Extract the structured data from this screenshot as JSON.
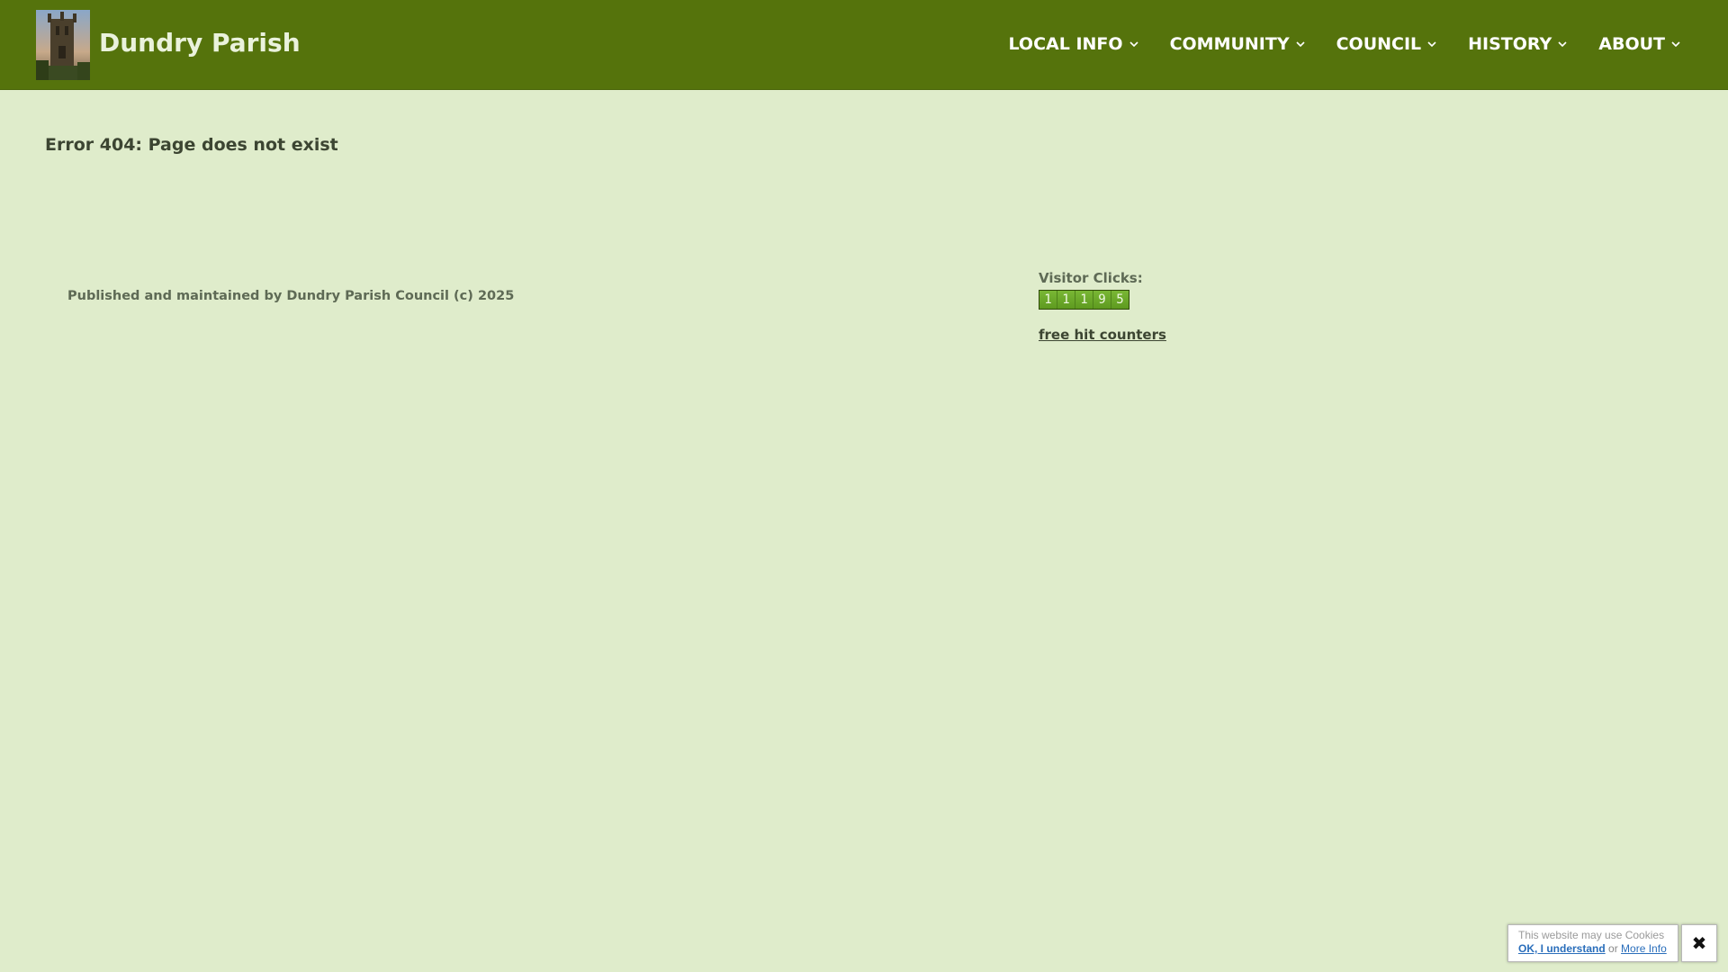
{
  "header": {
    "site_title": "Dundry Parish",
    "logo_icon": "church-tower-photo",
    "background": "#55730c",
    "nav": [
      {
        "label": "LOCAL INFO",
        "icon": "chevron-down-icon"
      },
      {
        "label": "COMMUNITY",
        "icon": "chevron-down-icon"
      },
      {
        "label": "COUNCIL",
        "icon": "chevron-down-icon"
      },
      {
        "label": "HISTORY",
        "icon": "chevron-down-icon"
      },
      {
        "label": "ABOUT",
        "icon": "chevron-down-icon"
      }
    ]
  },
  "main": {
    "error_title": "Error 404: Page does not exist"
  },
  "footer": {
    "published_text": "Published and maintained by Dundry Parish Council (c) 2025",
    "visitor_label": "Visitor Clicks:",
    "counter_digits": [
      "1",
      "1",
      "1",
      "9",
      "5"
    ],
    "counter_link": "free hit counters"
  },
  "cookie_notice": {
    "message": "This website may use Cookies",
    "ok_label": "OK, I understand",
    "separator": "or",
    "more_label": "More Info",
    "close_icon": "close-icon",
    "close_glyph": "✖"
  },
  "colors": {
    "page_background": "#dfeccb",
    "header_background": "#55730c",
    "counter_green": "#6aa22a"
  }
}
